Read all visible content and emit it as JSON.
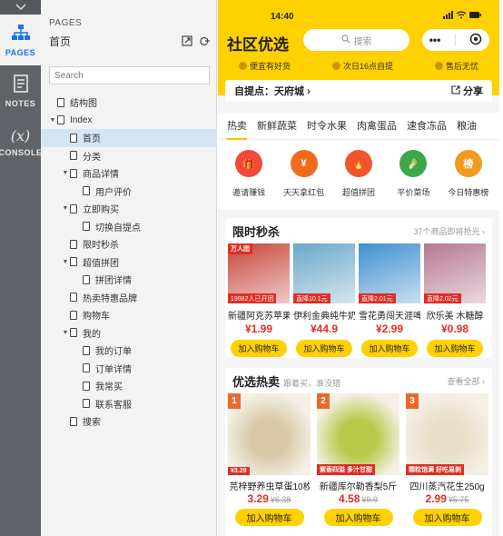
{
  "rail": {
    "top_icon": "chevron-down",
    "items": [
      {
        "label": "PAGES",
        "icon": "pages-icon",
        "active": true
      },
      {
        "label": "NOTES",
        "icon": "notes-icon"
      },
      {
        "label": "CONSOLE",
        "icon": "fx-icon",
        "glyph": "(x)"
      }
    ]
  },
  "panel": {
    "caption": "PAGES",
    "title": "首页",
    "search_placeholder": "Search",
    "tree": [
      {
        "label": "结构图",
        "indent": 0,
        "caret": false
      },
      {
        "label": "Index",
        "indent": 0,
        "caret": true
      },
      {
        "label": "首页",
        "indent": 1,
        "caret": false,
        "selected": true
      },
      {
        "label": "分类",
        "indent": 1,
        "caret": false
      },
      {
        "label": "商品详情",
        "indent": 1,
        "caret": true
      },
      {
        "label": "用户评价",
        "indent": 2,
        "caret": false
      },
      {
        "label": "立即购买",
        "indent": 1,
        "caret": true
      },
      {
        "label": "切换自提点",
        "indent": 2,
        "caret": false
      },
      {
        "label": "限时秒杀",
        "indent": 1,
        "caret": false
      },
      {
        "label": "超值拼团",
        "indent": 1,
        "caret": true
      },
      {
        "label": "拼团详情",
        "indent": 2,
        "caret": false
      },
      {
        "label": "热卖特惠品牌",
        "indent": 1,
        "caret": false
      },
      {
        "label": "购物车",
        "indent": 1,
        "caret": false
      },
      {
        "label": "我的",
        "indent": 1,
        "caret": true
      },
      {
        "label": "我的订单",
        "indent": 2,
        "caret": false
      },
      {
        "label": "订单详情",
        "indent": 2,
        "caret": false
      },
      {
        "label": "我常买",
        "indent": 2,
        "caret": false
      },
      {
        "label": "联系客服",
        "indent": 2,
        "caret": false
      },
      {
        "label": "搜索",
        "indent": 1,
        "caret": false
      }
    ]
  },
  "phone": {
    "time": "14:40",
    "brand": "社区优选",
    "search_label": "搜索",
    "capsule_more": "•••",
    "perks": [
      "便宜有好货",
      "次日16点自提",
      "售后无忧"
    ],
    "pickup_label": "自提点：天府城",
    "share_label": "分享",
    "categories": [
      "热卖",
      "新鲜蔬菜",
      "时令水果",
      "肉禽蛋品",
      "速食冻品",
      "粮油"
    ],
    "quick": [
      {
        "label": "邀请赚钱",
        "color": "#ef4a3a",
        "glyph": "🎁"
      },
      {
        "label": "天天拿红包",
        "color": "#f26b1d",
        "glyph": "¥"
      },
      {
        "label": "超值拼团",
        "color": "#f2542d",
        "glyph": "🔥"
      },
      {
        "label": "平价菜场",
        "color": "#3da84a",
        "glyph": "🥬"
      },
      {
        "label": "今日特惠榜",
        "color": "#f29a1d",
        "glyph": "榜"
      }
    ],
    "flash": {
      "title": "限时秒杀",
      "more": "37个商品即将抢光 ›",
      "items": [
        {
          "name": "新疆阿克苏苹果",
          "price": "¥1.99",
          "tag": "19982人已开团",
          "badge": "万人团",
          "btn": "加入购物车",
          "color": "#c8453b"
        },
        {
          "name": "伊利金典纯牛奶",
          "price": "¥44.9",
          "tag": "直降10.1元",
          "badge": "",
          "btn": "加入购物车",
          "color": "#6aa7c9"
        },
        {
          "name": "雪花勇闯天涯啤酒",
          "price": "¥2.99",
          "tag": "直降2.01元",
          "badge": "",
          "btn": "加入购物车",
          "color": "#3f8fd0"
        },
        {
          "name": "欣乐美 木糖醇",
          "price": "¥0.98",
          "tag": "直降2.02元",
          "badge": "",
          "btn": "加入购物车",
          "color": "#b57890"
        }
      ]
    },
    "hot": {
      "title": "优选热卖",
      "sub": "跟着买，准没错",
      "more": "查看全部 ›",
      "items": [
        {
          "rank": "1",
          "name": "芫梓野养虫草蛋10枚",
          "price": "3.29",
          "old": "¥6.38",
          "btn": "加入购物车",
          "color": "#d9c9a8",
          "badge": "¥3.29"
        },
        {
          "rank": "2",
          "name": "新疆库尔勒香梨5斤",
          "price": "4.58",
          "old": "¥9.9",
          "btn": "加入购物车",
          "color": "#b9c94a",
          "badge": "紫香四溢 多汁甘甜"
        },
        {
          "rank": "3",
          "name": "四川蒸汽花生250g",
          "price": "2.99",
          "old": "¥5.75",
          "btn": "加入购物车",
          "color": "#e9dfc9",
          "badge": "颗粒饱满 好吃易剥"
        }
      ]
    }
  }
}
